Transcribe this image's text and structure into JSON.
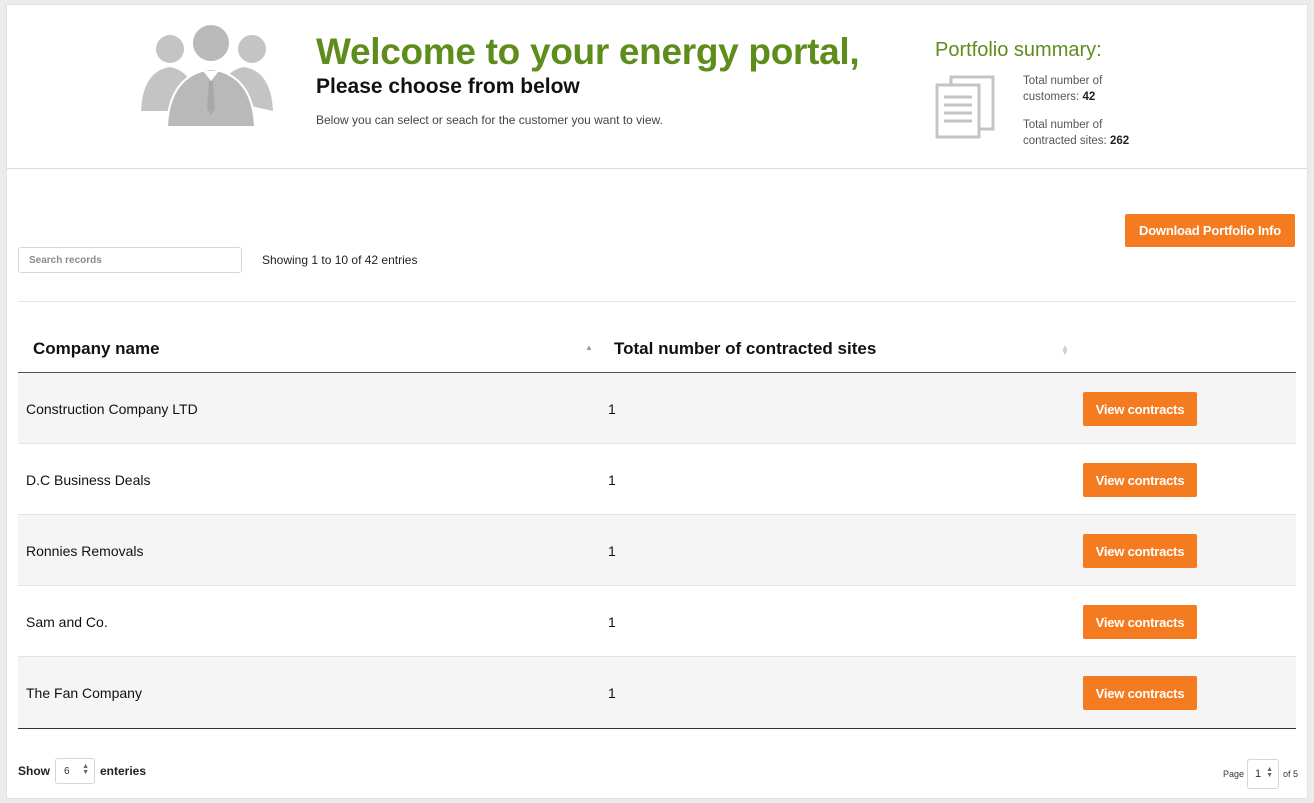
{
  "header": {
    "welcome": "Welcome to your energy portal,",
    "subtitle": "Please choose from below",
    "intro": "Below you can select or seach for the customer you want to view."
  },
  "portfolio": {
    "title": "Portfolio summary:",
    "customers_label": "Total number of customers:",
    "customers_value": "42",
    "sites_label": "Total number of contracted sites:",
    "sites_value": "262"
  },
  "toolbar": {
    "download_label": "Download Portfolio Info",
    "search_placeholder": "Search records",
    "search_value": "",
    "showing_text": "Showing 1 to 10 of 42 entries"
  },
  "table": {
    "columns": [
      "Company name",
      "Total number of contracted sites"
    ],
    "rows": [
      {
        "company": "Construction Company LTD",
        "sites": "1",
        "action": "View contracts"
      },
      {
        "company": "D.C Business Deals",
        "sites": "1",
        "action": "View contracts"
      },
      {
        "company": "Ronnies Removals",
        "sites": "1",
        "action": "View contracts"
      },
      {
        "company": "Sam and Co.",
        "sites": "1",
        "action": "View contracts"
      },
      {
        "company": "The Fan Company",
        "sites": "1",
        "action": "View contracts"
      }
    ]
  },
  "footer": {
    "show_label": "Show",
    "show_value": "6",
    "enteries_label": "enteries",
    "page_label": "Page",
    "page_value": "1",
    "of_label": "of 5"
  },
  "colors": {
    "accent_orange": "#f47b20",
    "brand_green": "#5e8d1c",
    "icon_gray": "#c4c4c4"
  },
  "icons": [
    "people-group-icon",
    "documents-icon",
    "sort-ascending-icon",
    "sort-both-icon"
  ]
}
